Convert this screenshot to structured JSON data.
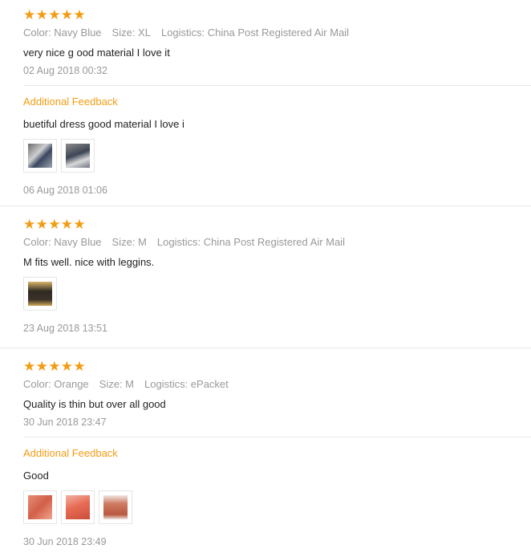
{
  "colors": {
    "accent": "#f39c12",
    "meta": "#999999",
    "divider": "#e8e8e8"
  },
  "reviews": [
    {
      "rating": 5,
      "color_label": "Color: Navy Blue",
      "size_label": "Size: XL",
      "logistics_label": "Logistics: China Post Registered Air Mail",
      "text": "very nice g ood material I love it",
      "date": "02 Aug 2018 00:32",
      "additional": {
        "label": "Additional Feedback",
        "text": "buetiful dress good material I love i",
        "photos": [
          "review-photo-1",
          "review-photo-2"
        ],
        "date": "06 Aug 2018 01:06"
      }
    },
    {
      "rating": 5,
      "color_label": "Color: Navy Blue",
      "size_label": "Size: M",
      "logistics_label": "Logistics: China Post Registered Air Mail",
      "text": "M fits well. nice with leggins.",
      "photos": [
        "review-photo-1"
      ],
      "date": "23 Aug 2018 13:51"
    },
    {
      "rating": 5,
      "color_label": "Color: Orange",
      "size_label": "Size: M",
      "logistics_label": "Logistics: ePacket",
      "text": "Quality is thin but over all good",
      "date": "30 Jun 2018 23:47",
      "additional": {
        "label": "Additional Feedback",
        "text": "Good",
        "photos": [
          "review-photo-1",
          "review-photo-2",
          "review-photo-3"
        ],
        "date": "30 Jun 2018 23:49"
      }
    }
  ]
}
